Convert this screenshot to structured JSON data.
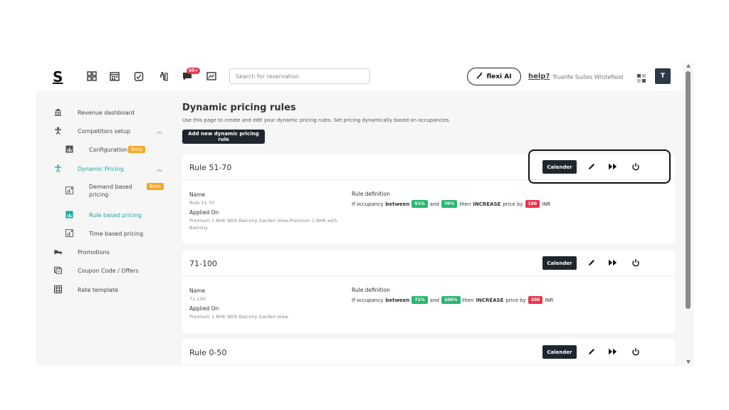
{
  "header": {
    "logo": "S",
    "notif_badge": "99+",
    "search_placeholder": "Search for reservation",
    "flexi_label": "flexi AI",
    "help_label": "help?",
    "hotel_name": "Truelife Suites Whitefield",
    "avatar_initial": "T"
  },
  "sidebar": {
    "items": [
      {
        "label": "Revenue dashboard",
        "icon": "bank-icon"
      },
      {
        "label": "Competitors setup",
        "icon": "person-icon"
      },
      {
        "label": "Configuration",
        "icon": "chart-icon",
        "badge": "Beta"
      },
      {
        "label": "Dynamic Pricing",
        "icon": "person-icon"
      },
      {
        "label": "Demand based pricing",
        "icon": "chart-plus-icon",
        "badge": "Beta"
      },
      {
        "label": "Rule based pricing",
        "icon": "chart-icon"
      },
      {
        "label": "Time based pricing",
        "icon": "chart-plus-icon"
      },
      {
        "label": "Promotions",
        "icon": "bed-icon"
      },
      {
        "label": "Coupon Code / Offers",
        "icon": "coupon-icon"
      },
      {
        "label": "Rate template",
        "icon": "table-icon"
      }
    ],
    "active_color": "#1aa89a"
  },
  "main": {
    "title": "Dynamic pricing rules",
    "description": "Use this page to create and edit your dynamic pricing rules. Set pricing dynamically based on occupancies.",
    "add_button": "Add new dynamic pricing rule",
    "labels": {
      "name": "Name",
      "applied_on": "Applied On",
      "rule_definition": "Rule definition",
      "if_occupancy": "If occupancy",
      "between": "between",
      "and": "and",
      "then": "then",
      "increase": "INCREASE",
      "price_by": "price by",
      "calender": "Calender"
    },
    "rules": [
      {
        "title": "Rule 51-70",
        "name": "Rule 51-70",
        "applied_on": "Premium 1 BHK With Balcony Garden View,Premium 1 BHK with Balcony",
        "from": "51%",
        "to": "70%",
        "amount": "100",
        "currency": "INR"
      },
      {
        "title": "71-100",
        "name": "71-100",
        "applied_on": "Premium 1 BHK With Balcony Garden View",
        "from": "71%",
        "to": "100%",
        "amount": "200",
        "currency": "INR"
      },
      {
        "title": "Rule 0-50"
      }
    ]
  },
  "colors": {
    "dark_button": "#1f262d",
    "green_pill": "#2bb673",
    "red_pill": "#e8364f",
    "beta": "#f6a623"
  }
}
